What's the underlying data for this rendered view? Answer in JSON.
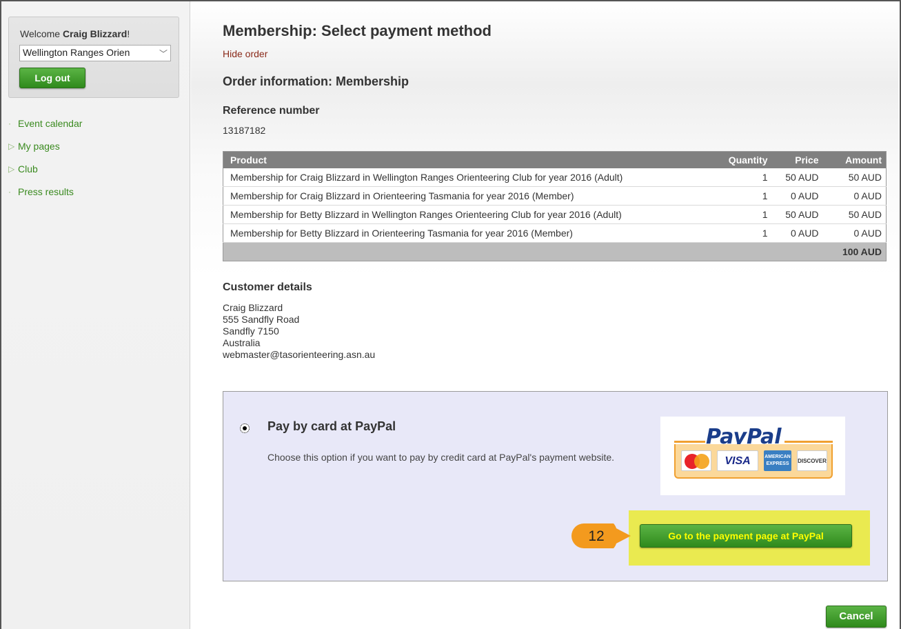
{
  "sidebar": {
    "welcome_prefix": "Welcome ",
    "user_name": "Craig Blizzard",
    "welcome_suffix": "!",
    "club_select_value": "Wellington Ranges Orien",
    "logout_label": "Log out",
    "nav_items": [
      {
        "label": "Event calendar",
        "bullet": "·"
      },
      {
        "label": "My pages",
        "bullet": "▷"
      },
      {
        "label": "Club",
        "bullet": "▷"
      },
      {
        "label": "Press results",
        "bullet": "·"
      }
    ]
  },
  "main": {
    "title": "Membership: Select payment method",
    "hide_order_link": "Hide order",
    "order_heading": "Order information: Membership",
    "reference_label": "Reference number",
    "reference_value": "13187182",
    "table": {
      "headers": {
        "product": "Product",
        "quantity": "Quantity",
        "price": "Price",
        "amount": "Amount"
      },
      "rows": [
        {
          "product": "Membership for Craig Blizzard in Wellington Ranges Orienteering Club for year 2016 (Adult)",
          "quantity": "1",
          "price": "50 AUD",
          "amount": "50 AUD"
        },
        {
          "product": "Membership for Craig Blizzard in Orienteering Tasmania for year 2016 (Member)",
          "quantity": "1",
          "price": "0 AUD",
          "amount": "0 AUD"
        },
        {
          "product": "Membership for Betty Blizzard in Wellington Ranges Orienteering Club for year 2016 (Adult)",
          "quantity": "1",
          "price": "50 AUD",
          "amount": "50 AUD"
        },
        {
          "product": "Membership for Betty Blizzard in Orienteering Tasmania for year 2016 (Member)",
          "quantity": "1",
          "price": "0 AUD",
          "amount": "0 AUD"
        }
      ],
      "total": "100 AUD"
    },
    "customer": {
      "heading": "Customer details",
      "lines": [
        "Craig Blizzard",
        "555 Sandfly Road",
        "Sandfly 7150",
        "Australia",
        "webmaster@tasorienteering.asn.au"
      ]
    },
    "payment": {
      "option_title": "Pay by card at PayPal",
      "option_desc": "Choose this option if you want to pay by credit card at PayPal's payment website.",
      "logo_text": "PayPal",
      "card_visa": "VISA",
      "card_amex": "AMERICAN EXPRESS",
      "card_discover": "DISCOVER",
      "go_button_label": "Go to the payment page at PayPal",
      "callout_number": "12",
      "callout_color": "#f39a1e",
      "highlight_color": "#eaea50"
    },
    "cancel_label": "Cancel"
  },
  "colors": {
    "accent_green": "#3a8a1f",
    "button_green": "#2f8a1c",
    "link_red": "#8a2a1a",
    "table_header": "#808080",
    "pay_box_bg": "#e8e8f8"
  }
}
